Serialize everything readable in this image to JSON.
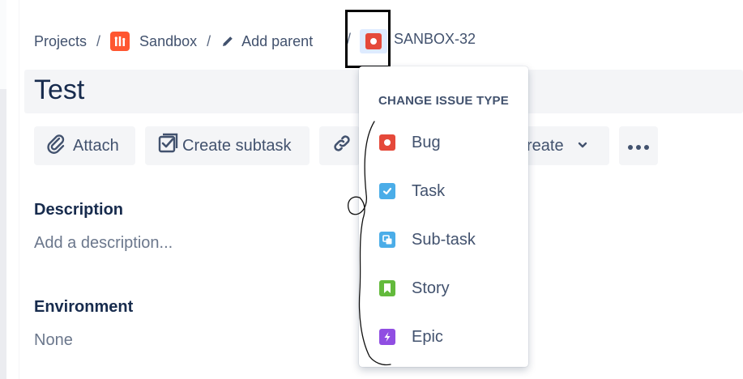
{
  "breadcrumbs": {
    "projects": "Projects",
    "project": "Sandbox",
    "add_parent": "Add parent",
    "separator": "/",
    "issue_key": "SANBOX-32"
  },
  "issue": {
    "title": "Test"
  },
  "toolbar": {
    "attach": "Attach",
    "create_subtask": "Create subtask",
    "create": "reate"
  },
  "fields": {
    "description_label": "Description",
    "description_placeholder": "Add a description...",
    "environment_label": "Environment",
    "environment_value": "None"
  },
  "dropdown": {
    "header": "CHANGE ISSUE TYPE",
    "items": [
      {
        "label": "Bug",
        "icon": "bug-icon",
        "color": "#e5493a"
      },
      {
        "label": "Task",
        "icon": "task-icon",
        "color": "#4bade8"
      },
      {
        "label": "Sub-task",
        "icon": "subtask-icon",
        "color": "#4bade8"
      },
      {
        "label": "Story",
        "icon": "story-icon",
        "color": "#63ba3c"
      },
      {
        "label": "Epic",
        "icon": "epic-icon",
        "color": "#904ee2"
      }
    ]
  },
  "colors": {
    "project_icon": "#ff5630",
    "highlight_border": "#000000",
    "selected_bg": "#deebff"
  }
}
